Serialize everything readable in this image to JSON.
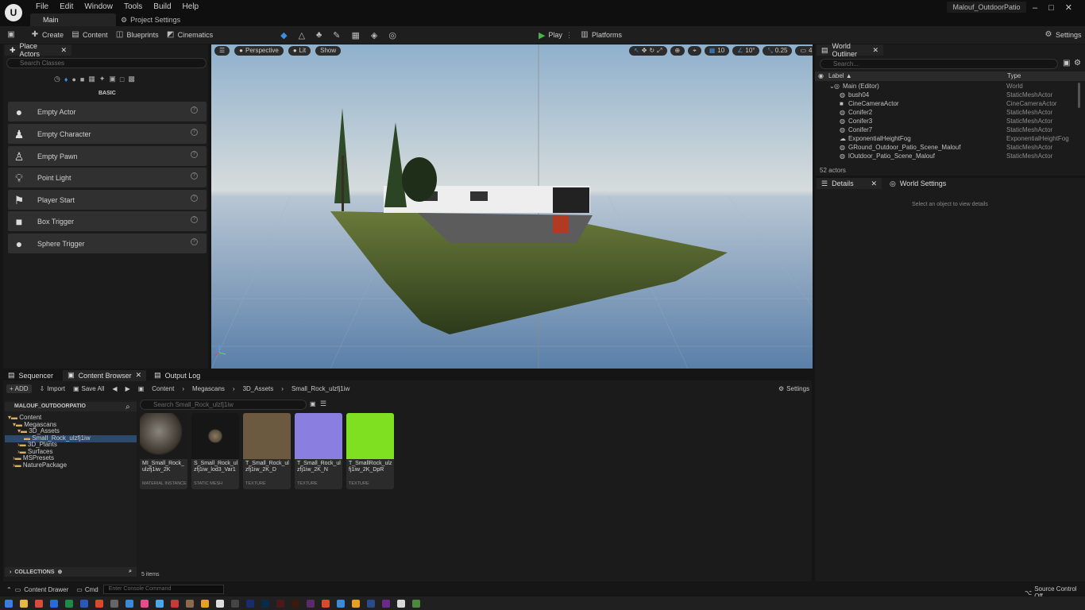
{
  "menu": [
    "File",
    "Edit",
    "Window",
    "Tools",
    "Build",
    "Help"
  ],
  "tabs": {
    "main": "Main",
    "project_settings": "Project Settings"
  },
  "project_name": "Malouf_OutdoorPatio",
  "toolbar": {
    "create": "Create",
    "content": "Content",
    "blueprints": "Blueprints",
    "cinematics": "Cinematics",
    "play": "Play",
    "platforms": "Platforms",
    "settings": "Settings"
  },
  "place_actors": {
    "tab": "Place Actors",
    "search_placeholder": "Search Classes",
    "category": "BASIC",
    "items": [
      {
        "label": "Empty Actor",
        "icon": "sphere-icon"
      },
      {
        "label": "Empty Character",
        "icon": "character-icon"
      },
      {
        "label": "Empty Pawn",
        "icon": "pawn-icon"
      },
      {
        "label": "Point Light",
        "icon": "light-bulb-icon"
      },
      {
        "label": "Player Start",
        "icon": "flag-icon"
      },
      {
        "label": "Box Trigger",
        "icon": "box-icon"
      },
      {
        "label": "Sphere Trigger",
        "icon": "sphere-icon"
      }
    ]
  },
  "viewport": {
    "perspective": "Perspective",
    "lit": "Lit",
    "show": "Show",
    "grid": "10",
    "angle": "10°",
    "scale": "0.25",
    "camera": "4"
  },
  "outliner": {
    "tab": "World Outliner",
    "search_placeholder": "Search...",
    "col_label": "Label ▲",
    "col_type": "Type",
    "rows": [
      {
        "name": "Main (Editor)",
        "type": "World"
      },
      {
        "name": "bush04",
        "type": "StaticMeshActor"
      },
      {
        "name": "CineCameraActor",
        "type": "CineCameraActor"
      },
      {
        "name": "Conifer2",
        "type": "StaticMeshActor"
      },
      {
        "name": "Conifer3",
        "type": "StaticMeshActor"
      },
      {
        "name": "Conifer7",
        "type": "StaticMeshActor"
      },
      {
        "name": "ExponentialHeightFog",
        "type": "ExponentialHeightFog"
      },
      {
        "name": "GRound_Outdoor_Patio_Scene_Malouf",
        "type": "StaticMeshActor"
      },
      {
        "name": "lOutdoor_Patio_Scene_Malouf",
        "type": "StaticMeshActor"
      }
    ],
    "count": "52 actors"
  },
  "details": {
    "tab": "Details",
    "world_settings": "World Settings",
    "empty": "Select an object to view details"
  },
  "bottom_tabs": {
    "sequencer": "Sequencer",
    "content_browser": "Content Browser",
    "output_log": "Output Log"
  },
  "content_browser": {
    "add": "ADD",
    "import": "Import",
    "save_all": "Save All",
    "settings": "Settings",
    "breadcrumb": [
      "Content",
      "Megascans",
      "3D_Assets",
      "Small_Rock_ulzfj1iw"
    ],
    "project_root": "MALOUF_OUTDOORPATIO",
    "search_placeholder": "Search Small_Rock_ulzfj1iw",
    "tree": [
      "Content",
      "Megascans",
      "3D_Assets",
      "Small_Rock_ulzfj1iw",
      "3D_Plants",
      "Surfaces",
      "MSPresets",
      "NaturePackage"
    ],
    "assets": [
      {
        "name": "MI_Small_Rock_ulzfj1iw_2K",
        "type": "MATERIAL INSTANCE",
        "color": "#5a544c"
      },
      {
        "name": "S_Small_Rock_ulzfj1iw_lod3_Var1",
        "type": "STATIC MESH",
        "color": "#1a1a1a"
      },
      {
        "name": "T_Small_Rock_ulzfj1iw_2K_D",
        "type": "TEXTURE",
        "color": "#6b5a40"
      },
      {
        "name": "T_Small_Rock_ulzfj1iw_2K_N",
        "type": "TEXTURE",
        "color": "#8a7ee0"
      },
      {
        "name": "T_SmallRock_ulzfj1iw_2K_DpR",
        "type": "TEXTURE",
        "color": "#7ee020"
      }
    ],
    "collections": "COLLECTIONS",
    "count": "5 items"
  },
  "status": {
    "content_drawer": "Content Drawer",
    "cmd": "Cmd",
    "console_placeholder": "Enter Console Command",
    "source_control": "Source Control Off"
  }
}
